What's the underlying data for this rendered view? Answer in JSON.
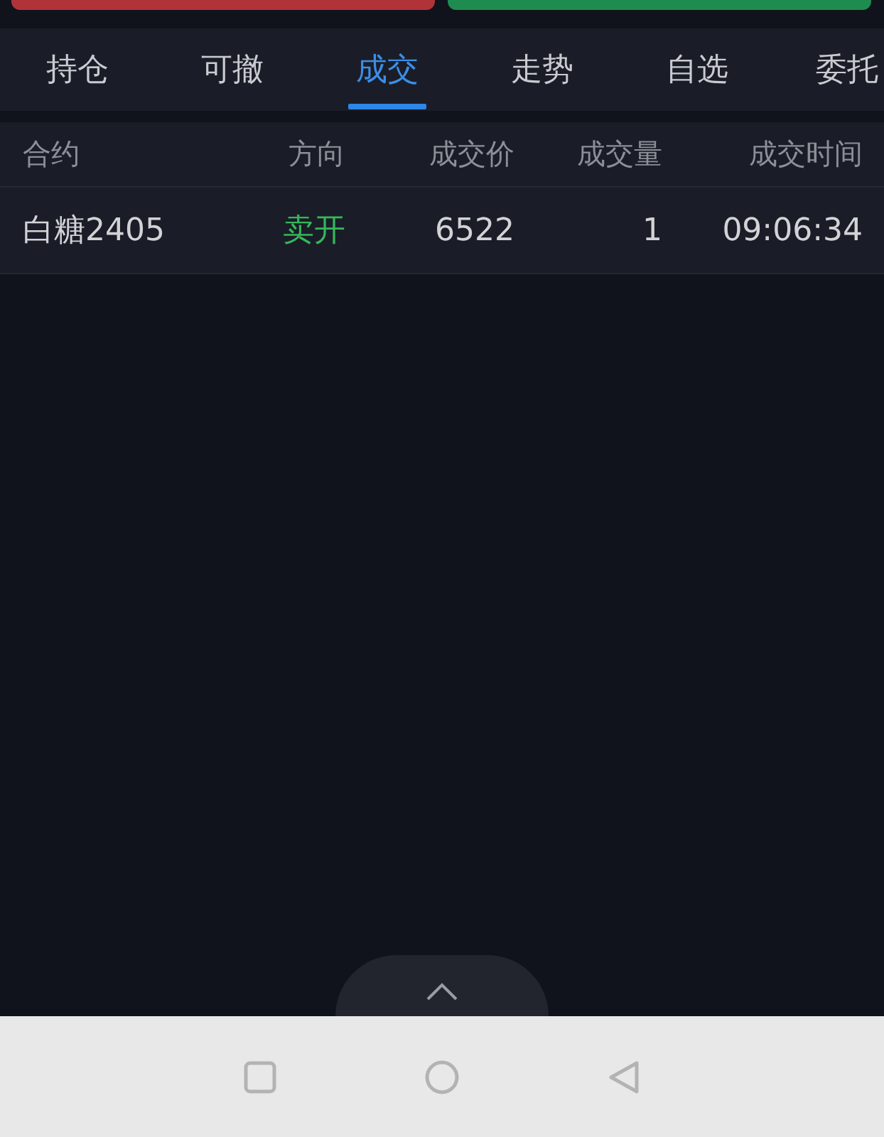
{
  "tabs": [
    {
      "label": "持仓",
      "selected": false
    },
    {
      "label": "可撤",
      "selected": false
    },
    {
      "label": "成交",
      "selected": true
    },
    {
      "label": "走势",
      "selected": false
    },
    {
      "label": "自选",
      "selected": false
    },
    {
      "label": "委托",
      "selected": false
    }
  ],
  "table": {
    "columns": [
      "合约",
      "方向",
      "成交价",
      "成交量",
      "成交时间"
    ],
    "rows": [
      {
        "cells": [
          "白糖2405",
          "卖开",
          "6522",
          "1",
          "09:06:34"
        ]
      }
    ]
  }
}
